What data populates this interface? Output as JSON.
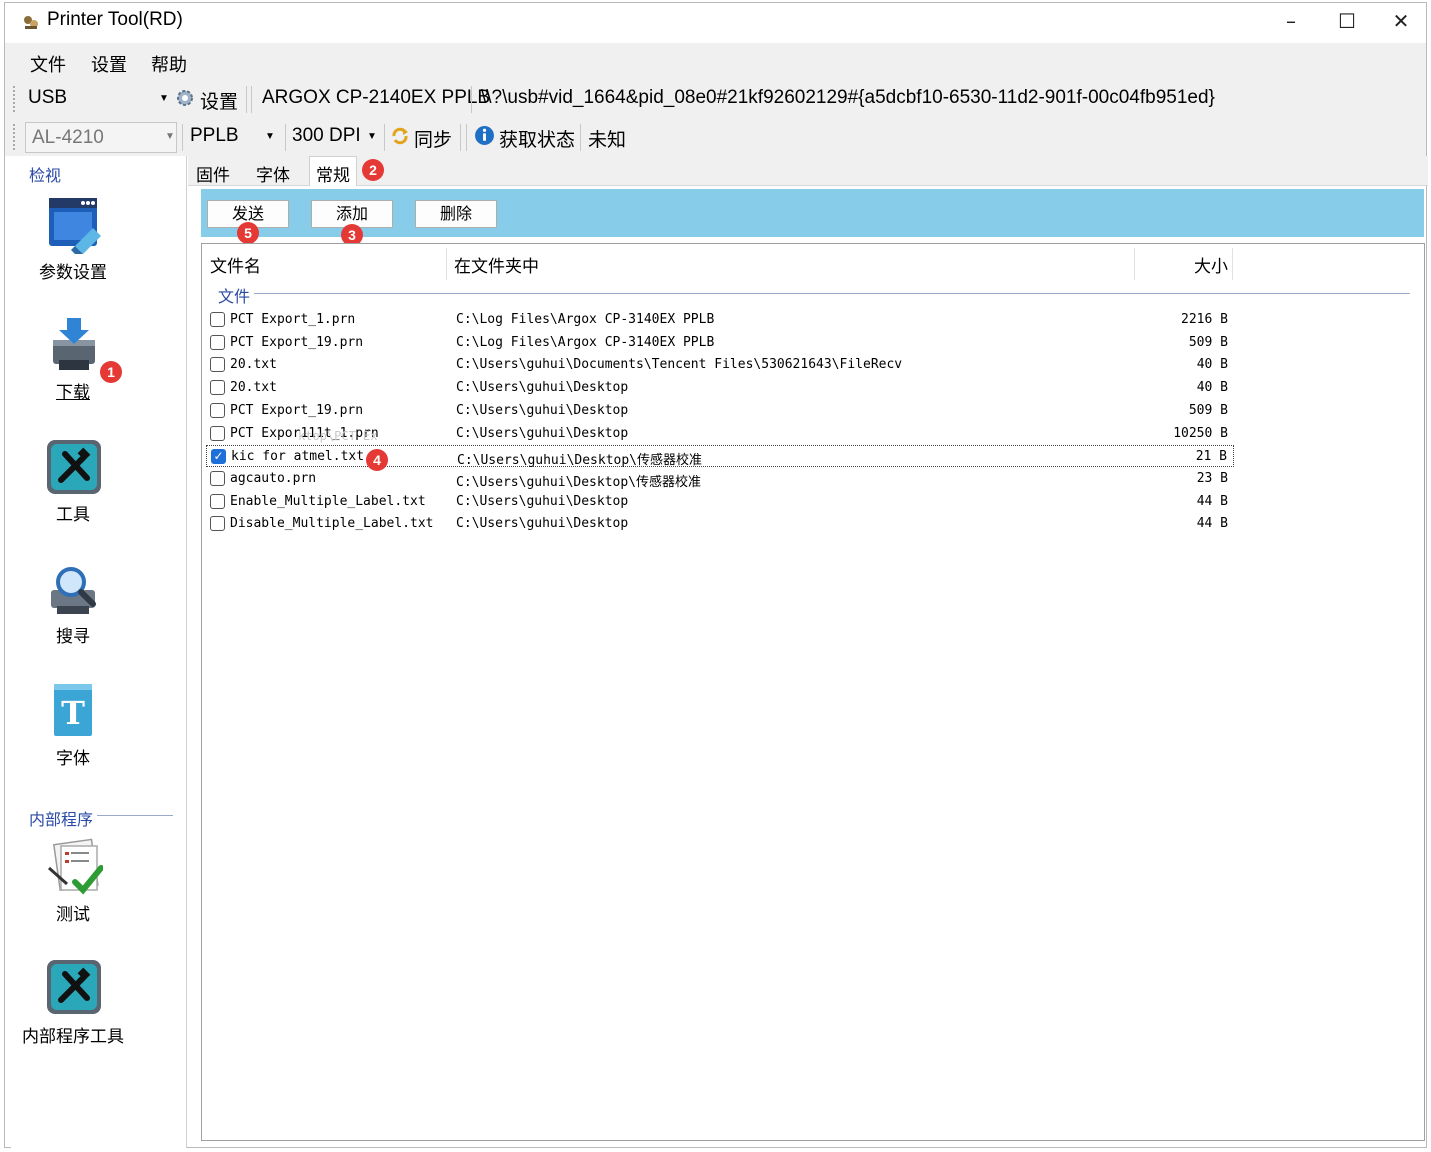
{
  "window": {
    "title": "Printer Tool(RD)",
    "minimize": "–",
    "maximize": "☐",
    "close": "✕"
  },
  "menu": {
    "file": "文件",
    "settings": "设置",
    "help": "帮助"
  },
  "toolbar1": {
    "port": "USB",
    "settings": "设置",
    "printer": "ARGOX CP-2140EX PPLB",
    "device_path": "\\\\?\\usb#vid_1664&pid_08e0#21kf92602129#{a5dcbf10-6530-11d2-901f-00c04fb951ed}"
  },
  "toolbar2": {
    "model": "AL-4210",
    "language": "PPLB",
    "dpi": "300 DPI",
    "sync": "同步",
    "get_status": "获取状态",
    "status": "未知"
  },
  "sidebar": {
    "group1": "检视",
    "items": [
      {
        "label": "参数设置",
        "icon": "parameter-settings-icon"
      },
      {
        "label": "下载",
        "icon": "download-printer-icon"
      },
      {
        "label": "工具",
        "icon": "tools-icon"
      },
      {
        "label": "搜寻",
        "icon": "search-printer-icon"
      },
      {
        "label": "字体",
        "icon": "font-icon"
      }
    ],
    "group2": "内部程序",
    "items2": [
      {
        "label": "测试",
        "icon": "test-checklist-icon"
      },
      {
        "label": "内部程序工具",
        "icon": "internal-tools-icon"
      }
    ]
  },
  "tabs": {
    "firmware": "固件",
    "font": "字体",
    "general": "常规"
  },
  "buttons": {
    "send": "发送",
    "add": "添加",
    "delete": "删除"
  },
  "table": {
    "headers": {
      "name": "文件名",
      "folder": "在文件夹中",
      "size": "大小"
    },
    "section": "文件",
    "rows": [
      {
        "name": "PCT Export_1.prn",
        "folder": "C:\\Log Files\\Argox CP-3140EX PPLB",
        "size": "2216 B",
        "checked": false
      },
      {
        "name": "PCT Export_19.prn",
        "folder": "C:\\Log Files\\Argox CP-3140EX PPLB",
        "size": "509 B",
        "checked": false
      },
      {
        "name": "20.txt",
        "folder": "C:\\Users\\guhui\\Documents\\Tencent Files\\530621643\\FileRecv",
        "size": "40 B",
        "checked": false
      },
      {
        "name": "20.txt",
        "folder": "C:\\Users\\guhui\\Desktop",
        "size": "40 B",
        "checked": false
      },
      {
        "name": "PCT Export_19.prn",
        "folder": "C:\\Users\\guhui\\Desktop",
        "size": "509 B",
        "checked": false
      },
      {
        "name": "PCT Expor111t_1.prn",
        "folder": "C:\\Users\\guhui\\Desktop",
        "size": "10250 B",
        "checked": false
      },
      {
        "name": "kic for atmel.txt",
        "folder": "C:\\Users\\guhui\\Desktop\\传感器校准",
        "size": "21 B",
        "checked": true
      },
      {
        "name": "agcauto.prn",
        "folder": "C:\\Users\\guhui\\Desktop\\传感器校准",
        "size": "23 B",
        "checked": false
      },
      {
        "name": "Enable_Multiple_Label.txt",
        "folder": "C:\\Users\\guhui\\Desktop",
        "size": "44 B",
        "checked": false
      },
      {
        "name": "Disable_Multiple_Label.txt",
        "folder": "C:\\Users\\guhui\\Desktop",
        "size": "44 B",
        "checked": false
      }
    ],
    "ghost_text": "ktop\\PCT Ex"
  },
  "badges": {
    "b1": "1",
    "b2": "2",
    "b3": "3",
    "b4": "4",
    "b5": "5"
  },
  "colors": {
    "button_bar": "#87cdea",
    "badge": "#e53935",
    "group_title": "#2b4aa6",
    "checkbox_on": "#1e6fd9"
  }
}
